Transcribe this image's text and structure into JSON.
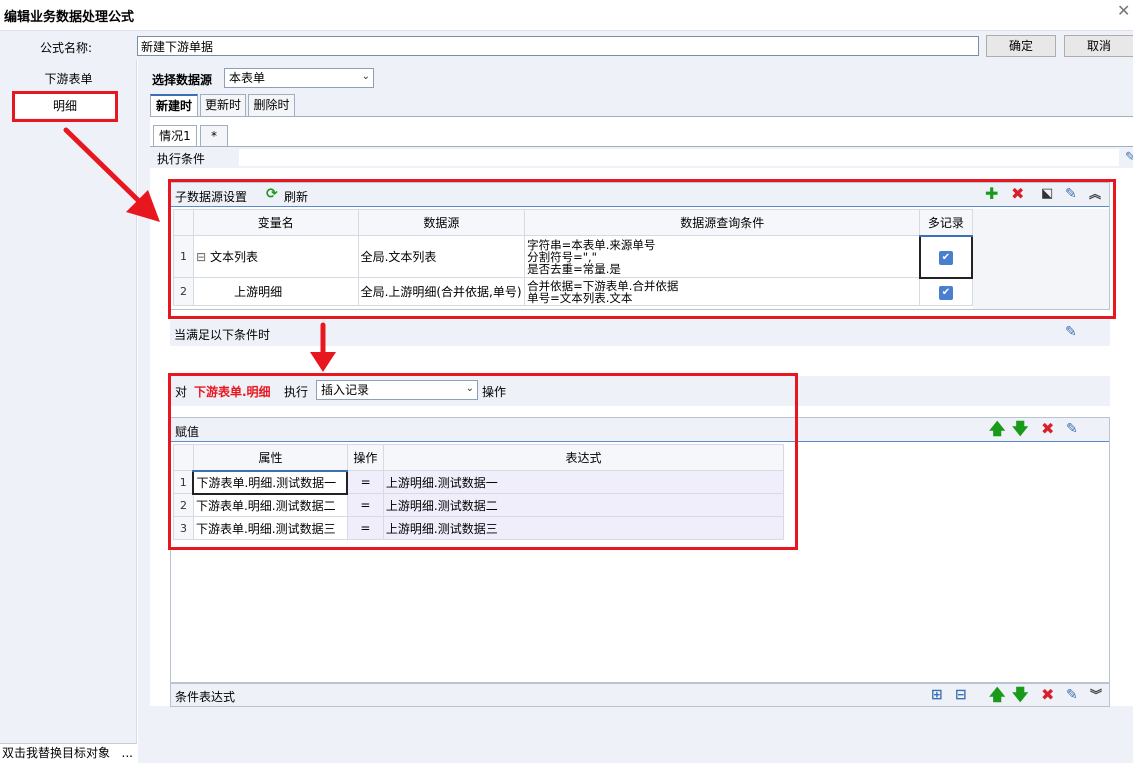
{
  "window": {
    "title": "编辑业务数据处理公式",
    "close_glyph": "✕"
  },
  "formula": {
    "name_label": "公式名称:",
    "name_value": "新建下游单据",
    "ok_label": "确定",
    "cancel_label": "取消"
  },
  "sidebar": {
    "items": [
      {
        "label": "下游表单"
      },
      {
        "label": "明细"
      }
    ],
    "status_text": "双击我替换目标对象",
    "status_more": "..."
  },
  "source": {
    "label": "选择数据源",
    "value": "本表单"
  },
  "tabs": [
    {
      "label": "新建时"
    },
    {
      "label": "更新时"
    },
    {
      "label": "删除时"
    }
  ],
  "case_tabs": [
    {
      "label": "情况1"
    },
    {
      "label": "*"
    }
  ],
  "exec_condition": {
    "label": "执行条件",
    "value": ""
  },
  "sub_ds": {
    "title": "子数据源设置",
    "refresh_label": "刷新",
    "headers": [
      "变量名",
      "数据源",
      "数据源查询条件",
      "多记录"
    ],
    "rows": [
      {
        "num": "1",
        "tree": "⊟",
        "name": "文本列表",
        "source": "全局.文本列表",
        "cond1": "字符串=本表单.来源单号",
        "cond2": "分割符号=\",\"",
        "cond3": "是否去重=常量.是",
        "multi": true
      },
      {
        "num": "2",
        "tree": "",
        "name": "上游明细",
        "source": "全局.上游明细(合并依据,单号)",
        "cond1": "合并依据=下游表单.合并依据",
        "cond2": "单号=文本列表.文本",
        "cond3": "",
        "multi": true
      }
    ]
  },
  "when": {
    "label": "当满足以下条件时"
  },
  "action": {
    "prefix": "对",
    "target": "下游表单.明细",
    "exec": "执行",
    "op_value": "插入记录",
    "suffix": "操作"
  },
  "assign": {
    "title": "赋值",
    "headers": [
      "属性",
      "操作",
      "表达式"
    ],
    "rows": [
      {
        "num": "1",
        "prop": "下游表单.明细.测试数据一",
        "op": "=",
        "expr": "上游明细.测试数据一"
      },
      {
        "num": "2",
        "prop": "下游表单.明细.测试数据二",
        "op": "=",
        "expr": "上游明细.测试数据二"
      },
      {
        "num": "3",
        "prop": "下游表单.明细.测试数据三",
        "op": "=",
        "expr": "上游明细.测试数据三"
      }
    ]
  },
  "cond_expr": {
    "label": "条件表达式"
  },
  "colors": {
    "accent": "#3b6fb6",
    "highlight_red": "#e8171f",
    "add_green": "#1a9a1a",
    "delete_red": "#d9202a"
  }
}
